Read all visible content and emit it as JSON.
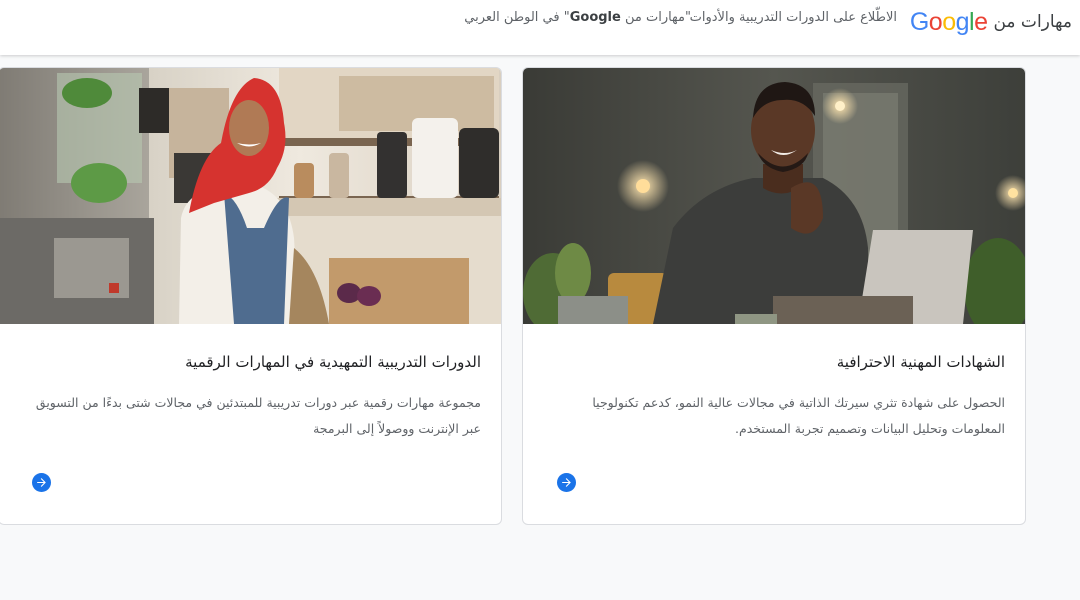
{
  "header": {
    "brand_prefix": "مهارات من",
    "brand_logo": "Google",
    "nav": [
      {
        "label": "الاطّلاع على الدورات التدريبية والأدوات"
      },
      {
        "label_before": "\"مهارات من ",
        "label_bold": "Google",
        "label_after": "\" في الوطن العربي"
      }
    ]
  },
  "cards": [
    {
      "title": "الشهادات المهنية الاحترافية",
      "description": "الحصول على شهادة تثري سيرتك الذاتية في مجالات عالية النمو، كدعم تكنولوجيا المعلومات وتحليل البيانات وتصميم تجربة المستخدم.",
      "image": "smiling-man-laptop-photo",
      "arrow_icon": "arrow-right-icon"
    },
    {
      "title": "الدورات التدريبية التمهيدية في المهارات الرقمية",
      "description": "مجموعة مهارات رقمية عبر دورات تدريبية للمبتدئين في مجالات شتى بدءًا من التسويق عبر الإنترنت ووصولاً إلى البرمجة",
      "image": "woman-hijab-shop-photo",
      "arrow_icon": "arrow-right-icon"
    }
  ],
  "colors": {
    "accent": "#1a73e8",
    "google_blue": "#4285F4",
    "google_red": "#EA4335",
    "google_yellow": "#FBBC05",
    "google_green": "#34A853"
  }
}
